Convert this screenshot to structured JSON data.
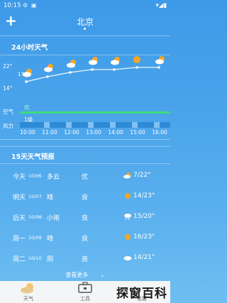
{
  "status": {
    "time": "10:15"
  },
  "header": {
    "city": "北京",
    "add": "+"
  },
  "hourly": {
    "title": "24小时天气",
    "ymax": "22°",
    "ymin": "14°",
    "temp_label": "17°",
    "aqi_row": "空气",
    "aqi_value": "优",
    "wind_row": "风力",
    "wind_value": "1级",
    "hours": [
      "10:00",
      "11:00",
      "12:00",
      "13:00",
      "14:00",
      "15:00",
      "16:00"
    ],
    "icons": [
      "cloud-sun-icon",
      "cloud-sun-icon",
      "cloud-sun-icon",
      "cloud-sun-icon",
      "cloud-sun-icon",
      "sun-icon",
      "cloud-sun-icon"
    ]
  },
  "forecast": {
    "title": "15天天气预报",
    "days": [
      {
        "day": "今天",
        "date": "10/06",
        "weather": "多云",
        "aqi": "优",
        "temp": "7/22°"
      },
      {
        "day": "明天",
        "date": "10/07",
        "weather": "晴",
        "aqi": "良",
        "temp": "14/23°"
      },
      {
        "day": "后天",
        "date": "10/08",
        "weather": "小雨",
        "aqi": "良",
        "temp": "15/20°"
      },
      {
        "day": "周一",
        "date": "10/09",
        "weather": "晴",
        "aqi": "良",
        "temp": "16/23°"
      },
      {
        "day": "周二",
        "date": "10/10",
        "weather": "阴",
        "aqi": "良",
        "temp": "14/21°"
      }
    ],
    "more": "查看更多"
  },
  "tabs": [
    "天气",
    "工具",
    "设置"
  ],
  "watermark": "探窗百科",
  "colors": {
    "accent": "#4aa3ea",
    "aqi_good": "#3ddc7a",
    "sun": "#f5a623"
  }
}
